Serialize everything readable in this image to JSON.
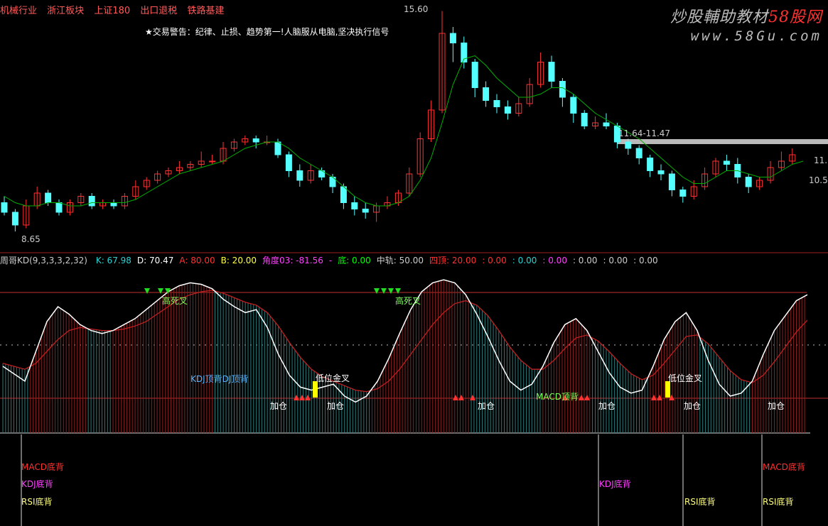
{
  "header_tags": [
    "机械行业",
    "浙江板块",
    "上证180",
    "出口退税",
    "铁路基建"
  ],
  "trade_warning": "★交易警告：纪律、止损、趋势第一!人脑服从电脑,坚决执行信号",
  "watermark": {
    "line1_a": "炒股輔助教材",
    "line1_b": "58股网",
    "line2": "www.58Gu.com"
  },
  "price_labels": {
    "high": "15.60",
    "low": "8.65",
    "range": "11.64-11.47",
    "right_a": "11.1",
    "right_b": "10.5"
  },
  "indicator": {
    "name": "周哥KD(9,3,3,3,2,32)",
    "fields": [
      {
        "text": "K: 67.98",
        "color": "#29d3d3"
      },
      {
        "text": "D: 70.47",
        "color": "#ffffff"
      },
      {
        "text": "A: 80.00",
        "color": "#ff3232"
      },
      {
        "text": "B: 20.00",
        "color": "#ffff40"
      },
      {
        "text": "角度03: -81.56",
        "color": "#ff40ff"
      },
      {
        "text": "-",
        "color": "#ff40ff"
      },
      {
        "text": "底: 0.00",
        "color": "#00ff00"
      },
      {
        "text": "中轨: 50.00",
        "color": "#cccccc"
      },
      {
        "text": "四顶: 20.00",
        "color": "#ff3232"
      },
      {
        "text": ": 0.00",
        "color": "#ff3232"
      },
      {
        "text": ": 0.00",
        "color": "#29d3d3"
      },
      {
        "text": ": 0.00",
        "color": "#ff40ff"
      },
      {
        "text": ": 0.00",
        "color": "#cccccc"
      },
      {
        "text": ": 0.00",
        "color": "#cccccc"
      },
      {
        "text": ": 0.00",
        "color": "#cccccc"
      }
    ]
  },
  "signals": {
    "top_cross": "高死叉",
    "kdj_top": "KDJ顶背DJ顶背",
    "low_cross": "低位金叉",
    "add": "加仓",
    "macd_top": "MACD顶背",
    "macd_bottom": "MACD底背",
    "kdj_bottom": "KDJ底背",
    "rsi_bottom": "RSI底背"
  },
  "colors": {
    "up": "#ff3232",
    "down": "#54ffff",
    "ma": "#00b000",
    "k": "#ffffff",
    "d": "#c02020"
  },
  "chart_data": {
    "type": "candlestick",
    "high_mark": 15.6,
    "low_mark": 8.65,
    "range_mark": [
      11.64,
      11.47
    ],
    "candles": [
      {
        "o": 9.6,
        "c": 9.3,
        "h": 9.8,
        "l": 9.2
      },
      {
        "o": 9.3,
        "c": 8.9,
        "h": 9.4,
        "l": 8.7
      },
      {
        "o": 8.9,
        "c": 9.5,
        "h": 9.7,
        "l": 8.8
      },
      {
        "o": 9.5,
        "c": 9.9,
        "h": 10.1,
        "l": 9.4
      },
      {
        "o": 9.9,
        "c": 9.6,
        "h": 10.0,
        "l": 9.5
      },
      {
        "o": 9.6,
        "c": 9.3,
        "h": 9.7,
        "l": 9.2
      },
      {
        "o": 9.3,
        "c": 9.6,
        "h": 9.7,
        "l": 9.2
      },
      {
        "o": 9.6,
        "c": 9.8,
        "h": 9.9,
        "l": 9.5
      },
      {
        "o": 9.8,
        "c": 9.5,
        "h": 9.9,
        "l": 9.4
      },
      {
        "o": 9.5,
        "c": 9.6,
        "h": 9.7,
        "l": 9.4
      },
      {
        "o": 9.6,
        "c": 9.5,
        "h": 9.7,
        "l": 9.4
      },
      {
        "o": 9.5,
        "c": 9.8,
        "h": 9.9,
        "l": 9.4
      },
      {
        "o": 9.8,
        "c": 10.1,
        "h": 10.3,
        "l": 9.7
      },
      {
        "o": 10.1,
        "c": 10.3,
        "h": 10.4,
        "l": 10.0
      },
      {
        "o": 10.3,
        "c": 10.5,
        "h": 10.6,
        "l": 10.2
      },
      {
        "o": 10.5,
        "c": 10.6,
        "h": 10.7,
        "l": 10.4
      },
      {
        "o": 10.6,
        "c": 10.7,
        "h": 10.9,
        "l": 10.5
      },
      {
        "o": 10.7,
        "c": 10.8,
        "h": 10.9,
        "l": 10.6
      },
      {
        "o": 10.8,
        "c": 10.9,
        "h": 11.2,
        "l": 10.7
      },
      {
        "o": 10.9,
        "c": 10.9,
        "h": 11.1,
        "l": 10.8
      },
      {
        "o": 10.9,
        "c": 11.3,
        "h": 11.5,
        "l": 10.8
      },
      {
        "o": 11.3,
        "c": 11.5,
        "h": 11.6,
        "l": 11.2
      },
      {
        "o": 11.5,
        "c": 11.6,
        "h": 11.7,
        "l": 11.4
      },
      {
        "o": 11.6,
        "c": 11.5,
        "h": 11.7,
        "l": 11.3
      },
      {
        "o": 11.5,
        "c": 11.5,
        "h": 11.7,
        "l": 11.4
      },
      {
        "o": 11.5,
        "c": 11.1,
        "h": 11.6,
        "l": 11.0
      },
      {
        "o": 11.1,
        "c": 10.6,
        "h": 11.2,
        "l": 10.4
      },
      {
        "o": 10.6,
        "c": 10.3,
        "h": 10.8,
        "l": 10.1
      },
      {
        "o": 10.3,
        "c": 10.6,
        "h": 10.8,
        "l": 10.2
      },
      {
        "o": 10.6,
        "c": 10.4,
        "h": 10.7,
        "l": 10.3
      },
      {
        "o": 10.4,
        "c": 10.1,
        "h": 10.5,
        "l": 9.9
      },
      {
        "o": 10.1,
        "c": 9.6,
        "h": 10.2,
        "l": 9.4
      },
      {
        "o": 9.6,
        "c": 9.4,
        "h": 9.8,
        "l": 9.2
      },
      {
        "o": 9.4,
        "c": 9.3,
        "h": 9.6,
        "l": 9.1
      },
      {
        "o": 9.3,
        "c": 9.5,
        "h": 9.6,
        "l": 9.0
      },
      {
        "o": 9.5,
        "c": 9.6,
        "h": 9.8,
        "l": 9.4
      },
      {
        "o": 9.6,
        "c": 9.9,
        "h": 10.0,
        "l": 9.5
      },
      {
        "o": 9.9,
        "c": 10.5,
        "h": 10.7,
        "l": 9.8
      },
      {
        "o": 10.5,
        "c": 11.6,
        "h": 11.8,
        "l": 10.4
      },
      {
        "o": 11.6,
        "c": 12.5,
        "h": 12.8,
        "l": 11.5
      },
      {
        "o": 12.5,
        "c": 14.9,
        "h": 15.6,
        "l": 12.4
      },
      {
        "o": 14.9,
        "c": 14.6,
        "h": 15.1,
        "l": 14.0
      },
      {
        "o": 14.6,
        "c": 14.0,
        "h": 14.8,
        "l": 13.8
      },
      {
        "o": 14.0,
        "c": 13.2,
        "h": 14.1,
        "l": 12.9
      },
      {
        "o": 13.2,
        "c": 12.8,
        "h": 13.4,
        "l": 12.6
      },
      {
        "o": 12.8,
        "c": 12.6,
        "h": 13.0,
        "l": 12.4
      },
      {
        "o": 12.6,
        "c": 12.4,
        "h": 12.8,
        "l": 12.2
      },
      {
        "o": 12.4,
        "c": 12.7,
        "h": 12.9,
        "l": 12.3
      },
      {
        "o": 12.7,
        "c": 13.3,
        "h": 13.5,
        "l": 12.6
      },
      {
        "o": 13.3,
        "c": 14.0,
        "h": 14.3,
        "l": 13.2
      },
      {
        "o": 14.0,
        "c": 13.4,
        "h": 14.2,
        "l": 13.2
      },
      {
        "o": 13.4,
        "c": 12.9,
        "h": 13.5,
        "l": 12.6
      },
      {
        "o": 12.9,
        "c": 12.4,
        "h": 13.0,
        "l": 12.1
      },
      {
        "o": 12.4,
        "c": 12.0,
        "h": 12.5,
        "l": 11.9
      },
      {
        "o": 12.0,
        "c": 12.1,
        "h": 12.3,
        "l": 11.9
      },
      {
        "o": 12.1,
        "c": 12.0,
        "h": 12.4,
        "l": 11.9
      },
      {
        "o": 12.0,
        "c": 11.5,
        "h": 12.1,
        "l": 11.3
      },
      {
        "o": 11.5,
        "c": 11.3,
        "h": 11.6,
        "l": 11.1
      },
      {
        "o": 11.3,
        "c": 11.0,
        "h": 11.4,
        "l": 10.8
      },
      {
        "o": 11.0,
        "c": 10.6,
        "h": 11.1,
        "l": 10.4
      },
      {
        "o": 10.6,
        "c": 10.5,
        "h": 10.8,
        "l": 10.3
      },
      {
        "o": 10.5,
        "c": 10.0,
        "h": 10.6,
        "l": 9.8
      },
      {
        "o": 10.0,
        "c": 9.8,
        "h": 10.1,
        "l": 9.6
      },
      {
        "o": 9.8,
        "c": 10.1,
        "h": 10.3,
        "l": 9.7
      },
      {
        "o": 10.1,
        "c": 10.5,
        "h": 10.7,
        "l": 10.0
      },
      {
        "o": 10.5,
        "c": 10.9,
        "h": 11.0,
        "l": 10.4
      },
      {
        "o": 10.9,
        "c": 10.8,
        "h": 11.1,
        "l": 10.6
      },
      {
        "o": 10.8,
        "c": 10.4,
        "h": 11.0,
        "l": 10.2
      },
      {
        "o": 10.4,
        "c": 10.1,
        "h": 10.5,
        "l": 9.9
      },
      {
        "o": 10.1,
        "c": 10.3,
        "h": 10.4,
        "l": 10.0
      },
      {
        "o": 10.3,
        "c": 10.7,
        "h": 10.9,
        "l": 10.2
      },
      {
        "o": 10.7,
        "c": 10.9,
        "h": 11.2,
        "l": 10.6
      },
      {
        "o": 10.9,
        "c": 11.1,
        "h": 11.3,
        "l": 10.8
      }
    ],
    "ma": [
      9.8,
      9.6,
      9.5,
      9.5,
      9.6,
      9.6,
      9.5,
      9.5,
      9.6,
      9.6,
      9.6,
      9.6,
      9.7,
      9.9,
      10.1,
      10.3,
      10.5,
      10.6,
      10.7,
      10.8,
      10.9,
      11.1,
      11.3,
      11.4,
      11.5,
      11.5,
      11.3,
      11.0,
      10.8,
      10.6,
      10.4,
      10.1,
      9.8,
      9.6,
      9.5,
      9.5,
      9.6,
      9.8,
      10.3,
      11.0,
      12.1,
      13.3,
      14.1,
      14.2,
      13.9,
      13.5,
      13.2,
      12.9,
      12.9,
      13.0,
      13.2,
      13.2,
      13.0,
      12.7,
      12.4,
      12.2,
      12.0,
      11.8,
      11.6,
      11.3,
      11.0,
      10.7,
      10.4,
      10.2,
      10.2,
      10.4,
      10.6,
      10.6,
      10.5,
      10.4,
      10.4,
      10.6,
      10.8,
      10.9
    ],
    "kd": {
      "k": [
        40,
        35,
        30,
        50,
        70,
        80,
        75,
        68,
        64,
        62,
        64,
        68,
        72,
        78,
        84,
        90,
        94,
        96,
        95,
        92,
        85,
        80,
        76,
        78,
        66,
        48,
        34,
        26,
        24,
        26,
        28,
        20,
        16,
        20,
        30,
        45,
        62,
        78,
        90,
        96,
        98,
        96,
        88,
        75,
        60,
        44,
        30,
        24,
        28,
        40,
        56,
        68,
        72,
        64,
        50,
        36,
        26,
        22,
        24,
        40,
        58,
        70,
        76,
        64,
        44,
        28,
        20,
        22,
        30,
        48,
        64,
        74,
        84,
        88
      ],
      "d": [
        42,
        40,
        38,
        42,
        50,
        58,
        64,
        66,
        65,
        64,
        64,
        65,
        67,
        70,
        75,
        80,
        85,
        88,
        90,
        91,
        89,
        86,
        83,
        81,
        76,
        67,
        56,
        46,
        38,
        33,
        30,
        27,
        24,
        23,
        25,
        30,
        38,
        48,
        58,
        68,
        76,
        82,
        84,
        81,
        74,
        64,
        53,
        44,
        38,
        38,
        44,
        52,
        59,
        61,
        57,
        50,
        42,
        35,
        31,
        34,
        42,
        51,
        60,
        61,
        55,
        46,
        37,
        31,
        29,
        34,
        43,
        53,
        63,
        71
      ]
    }
  }
}
